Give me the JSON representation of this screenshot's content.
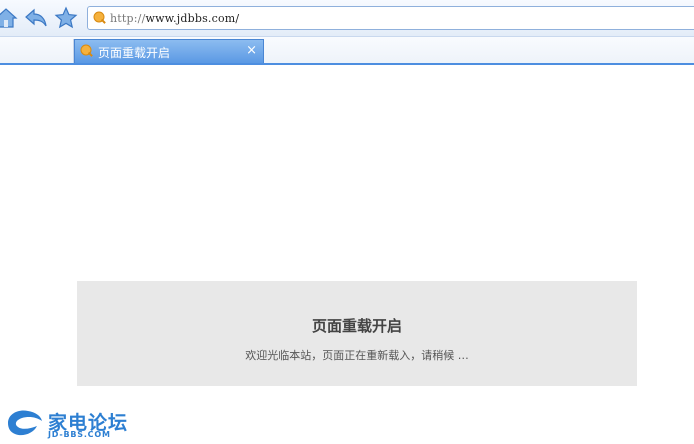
{
  "browser": {
    "address": {
      "protocol": "http://",
      "host": "www.jdbbs.com/"
    },
    "tab": {
      "title": "页面重载开启",
      "close": "×"
    }
  },
  "notice": {
    "title": "页面重载开启",
    "message": "欢迎光临本站，页面正在重新载入，请稍候 …"
  },
  "logo": {
    "name": "家电论坛",
    "domain": "JD-BBS.COM"
  },
  "colors": {
    "accent": "#4d8ee0",
    "tab_active": "#5b99e4",
    "notice_bg": "#e8e8e8",
    "logo_blue": "#2d7fd2"
  },
  "icons": [
    "home-icon",
    "back-icon",
    "star-icon",
    "favicon-icon",
    "close-icon"
  ]
}
